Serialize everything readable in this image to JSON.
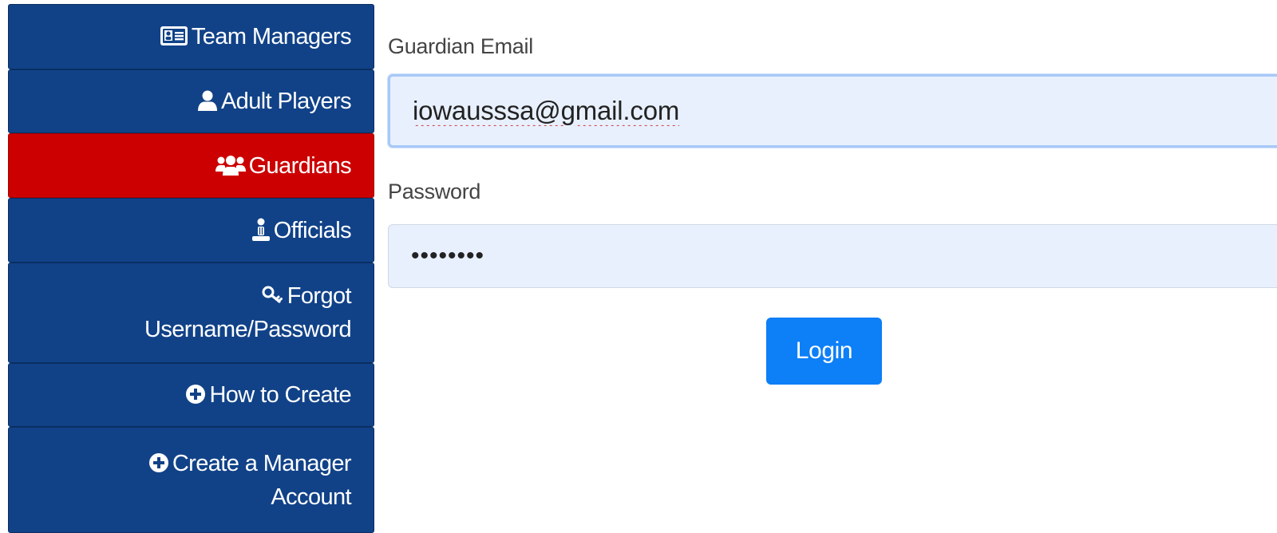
{
  "sidebar": {
    "items": [
      {
        "label": "Team Managers",
        "icon": "id-card-icon",
        "active": false
      },
      {
        "label": "Adult Players",
        "icon": "user-icon",
        "active": false
      },
      {
        "label": "Guardians",
        "icon": "users-icon",
        "active": true
      },
      {
        "label": "Officials",
        "icon": "referee-icon",
        "active": false
      },
      {
        "label_line1": "Forgot",
        "label_line2": "Username/Password",
        "icon": "key-icon",
        "active": false
      },
      {
        "label": "How to Create",
        "icon": "plus-circle-icon",
        "active": false
      },
      {
        "label_line1": "Create a Manager",
        "label_line2": "Account",
        "icon": "plus-circle-icon",
        "active": false
      }
    ]
  },
  "form": {
    "email_label": "Guardian Email",
    "email_value": "iowausssa@gmail.com",
    "password_label": "Password",
    "password_value": "••••••••",
    "login_label": "Login"
  },
  "colors": {
    "nav_background": "#114288",
    "nav_active": "#cc0000",
    "input_background": "#e8f0fe",
    "button": "#0d7ff7"
  }
}
